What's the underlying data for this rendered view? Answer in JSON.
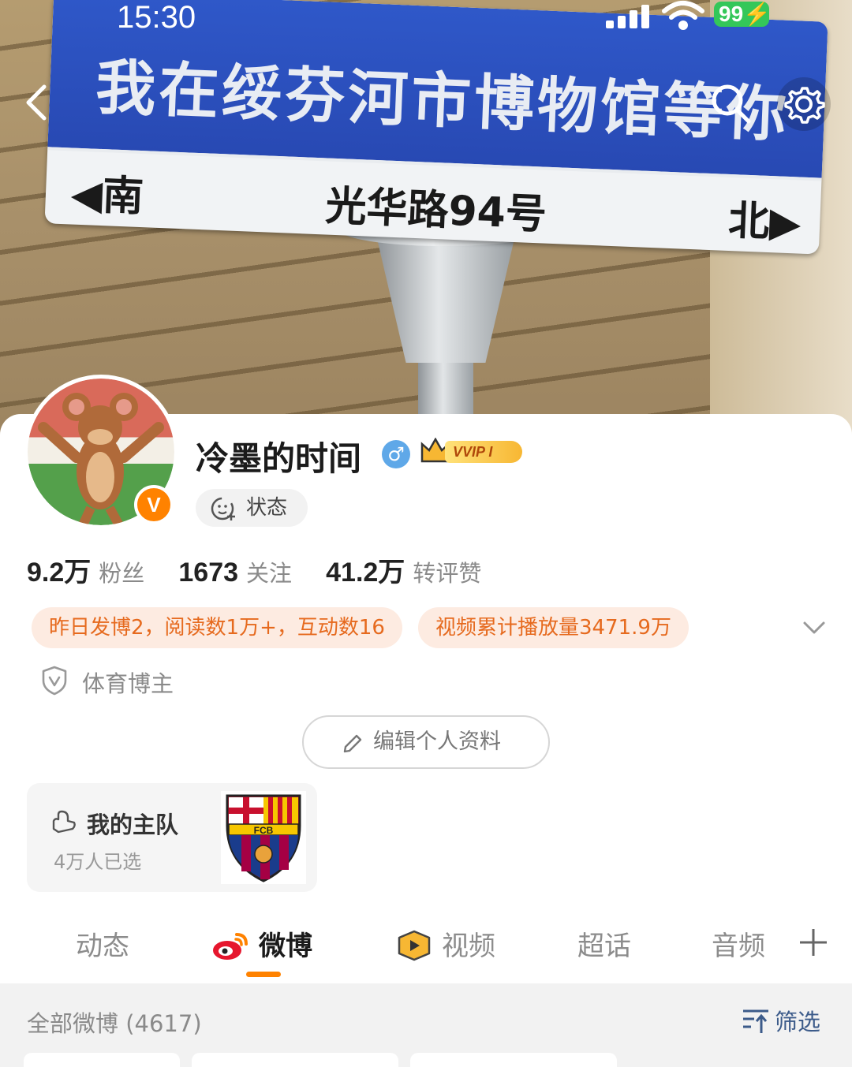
{
  "status_bar": {
    "time": "15:30",
    "battery": "99"
  },
  "cover": {
    "sign_main": "我在绥芬河市博物馆等你",
    "sign_south": "◀南",
    "sign_road": "光华路94号",
    "sign_north": "北▶"
  },
  "nav": {
    "back_icon": "chevron-left-icon",
    "search_icon": "search-icon",
    "settings_icon": "gear-icon"
  },
  "profile": {
    "username": "冷墨的时间",
    "gender_symbol": "♂",
    "vvip_label": "VVIP I",
    "verified_badge": "V",
    "status_button": "状态"
  },
  "stats": [
    {
      "value": "9.2万",
      "label": "粉丝"
    },
    {
      "value": "1673",
      "label": "关注"
    },
    {
      "value": "41.2万",
      "label": "转评赞"
    }
  ],
  "highlights": [
    "昨日发博2，阅读数1万+，互动数16",
    "视频累计播放量3471.9万"
  ],
  "tag": {
    "label": "体育博主"
  },
  "edit_profile": {
    "label": "编辑个人资料"
  },
  "team": {
    "title": "我的主队",
    "subtitle": "4万人已选",
    "crest_text": "FCB"
  },
  "tabs": [
    {
      "label": "动态",
      "active": false
    },
    {
      "label": "微博",
      "active": true
    },
    {
      "label": "视频",
      "active": false
    },
    {
      "label": "超话",
      "active": false
    },
    {
      "label": "音频",
      "active": false
    }
  ],
  "feed": {
    "count_label": "全部微博 (4617)",
    "filter_label": "筛选"
  },
  "colors": {
    "accent": "#ff8200",
    "highlight_bg": "#fdebe1",
    "highlight_text": "#e66a1e",
    "link": "#3c5b8a"
  }
}
